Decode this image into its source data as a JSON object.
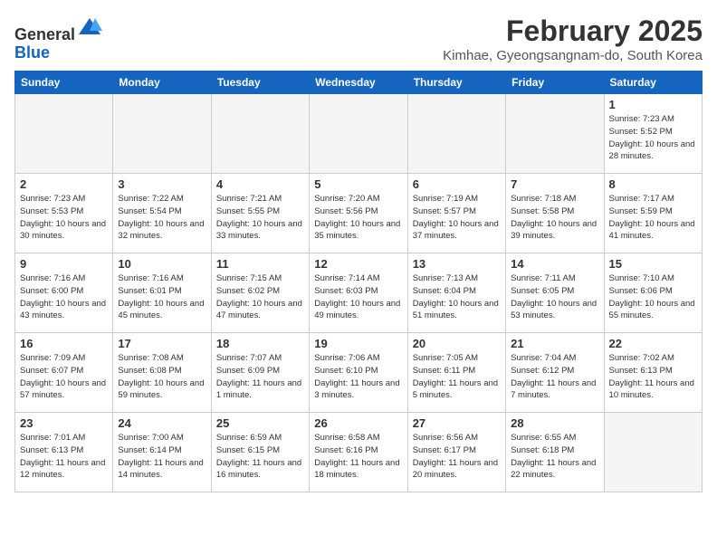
{
  "logo": {
    "line1": "General",
    "line2": "Blue"
  },
  "title": "February 2025",
  "location": "Kimhae, Gyeongsangnam-do, South Korea",
  "weekdays": [
    "Sunday",
    "Monday",
    "Tuesday",
    "Wednesday",
    "Thursday",
    "Friday",
    "Saturday"
  ],
  "weeks": [
    [
      {
        "day": "",
        "info": ""
      },
      {
        "day": "",
        "info": ""
      },
      {
        "day": "",
        "info": ""
      },
      {
        "day": "",
        "info": ""
      },
      {
        "day": "",
        "info": ""
      },
      {
        "day": "",
        "info": ""
      },
      {
        "day": "1",
        "info": "Sunrise: 7:23 AM\nSunset: 5:52 PM\nDaylight: 10 hours and 28 minutes."
      }
    ],
    [
      {
        "day": "2",
        "info": "Sunrise: 7:23 AM\nSunset: 5:53 PM\nDaylight: 10 hours and 30 minutes."
      },
      {
        "day": "3",
        "info": "Sunrise: 7:22 AM\nSunset: 5:54 PM\nDaylight: 10 hours and 32 minutes."
      },
      {
        "day": "4",
        "info": "Sunrise: 7:21 AM\nSunset: 5:55 PM\nDaylight: 10 hours and 33 minutes."
      },
      {
        "day": "5",
        "info": "Sunrise: 7:20 AM\nSunset: 5:56 PM\nDaylight: 10 hours and 35 minutes."
      },
      {
        "day": "6",
        "info": "Sunrise: 7:19 AM\nSunset: 5:57 PM\nDaylight: 10 hours and 37 minutes."
      },
      {
        "day": "7",
        "info": "Sunrise: 7:18 AM\nSunset: 5:58 PM\nDaylight: 10 hours and 39 minutes."
      },
      {
        "day": "8",
        "info": "Sunrise: 7:17 AM\nSunset: 5:59 PM\nDaylight: 10 hours and 41 minutes."
      }
    ],
    [
      {
        "day": "9",
        "info": "Sunrise: 7:16 AM\nSunset: 6:00 PM\nDaylight: 10 hours and 43 minutes."
      },
      {
        "day": "10",
        "info": "Sunrise: 7:16 AM\nSunset: 6:01 PM\nDaylight: 10 hours and 45 minutes."
      },
      {
        "day": "11",
        "info": "Sunrise: 7:15 AM\nSunset: 6:02 PM\nDaylight: 10 hours and 47 minutes."
      },
      {
        "day": "12",
        "info": "Sunrise: 7:14 AM\nSunset: 6:03 PM\nDaylight: 10 hours and 49 minutes."
      },
      {
        "day": "13",
        "info": "Sunrise: 7:13 AM\nSunset: 6:04 PM\nDaylight: 10 hours and 51 minutes."
      },
      {
        "day": "14",
        "info": "Sunrise: 7:11 AM\nSunset: 6:05 PM\nDaylight: 10 hours and 53 minutes."
      },
      {
        "day": "15",
        "info": "Sunrise: 7:10 AM\nSunset: 6:06 PM\nDaylight: 10 hours and 55 minutes."
      }
    ],
    [
      {
        "day": "16",
        "info": "Sunrise: 7:09 AM\nSunset: 6:07 PM\nDaylight: 10 hours and 57 minutes."
      },
      {
        "day": "17",
        "info": "Sunrise: 7:08 AM\nSunset: 6:08 PM\nDaylight: 10 hours and 59 minutes."
      },
      {
        "day": "18",
        "info": "Sunrise: 7:07 AM\nSunset: 6:09 PM\nDaylight: 11 hours and 1 minute."
      },
      {
        "day": "19",
        "info": "Sunrise: 7:06 AM\nSunset: 6:10 PM\nDaylight: 11 hours and 3 minutes."
      },
      {
        "day": "20",
        "info": "Sunrise: 7:05 AM\nSunset: 6:11 PM\nDaylight: 11 hours and 5 minutes."
      },
      {
        "day": "21",
        "info": "Sunrise: 7:04 AM\nSunset: 6:12 PM\nDaylight: 11 hours and 7 minutes."
      },
      {
        "day": "22",
        "info": "Sunrise: 7:02 AM\nSunset: 6:13 PM\nDaylight: 11 hours and 10 minutes."
      }
    ],
    [
      {
        "day": "23",
        "info": "Sunrise: 7:01 AM\nSunset: 6:13 PM\nDaylight: 11 hours and 12 minutes."
      },
      {
        "day": "24",
        "info": "Sunrise: 7:00 AM\nSunset: 6:14 PM\nDaylight: 11 hours and 14 minutes."
      },
      {
        "day": "25",
        "info": "Sunrise: 6:59 AM\nSunset: 6:15 PM\nDaylight: 11 hours and 16 minutes."
      },
      {
        "day": "26",
        "info": "Sunrise: 6:58 AM\nSunset: 6:16 PM\nDaylight: 11 hours and 18 minutes."
      },
      {
        "day": "27",
        "info": "Sunrise: 6:56 AM\nSunset: 6:17 PM\nDaylight: 11 hours and 20 minutes."
      },
      {
        "day": "28",
        "info": "Sunrise: 6:55 AM\nSunset: 6:18 PM\nDaylight: 11 hours and 22 minutes."
      },
      {
        "day": "",
        "info": ""
      }
    ]
  ]
}
